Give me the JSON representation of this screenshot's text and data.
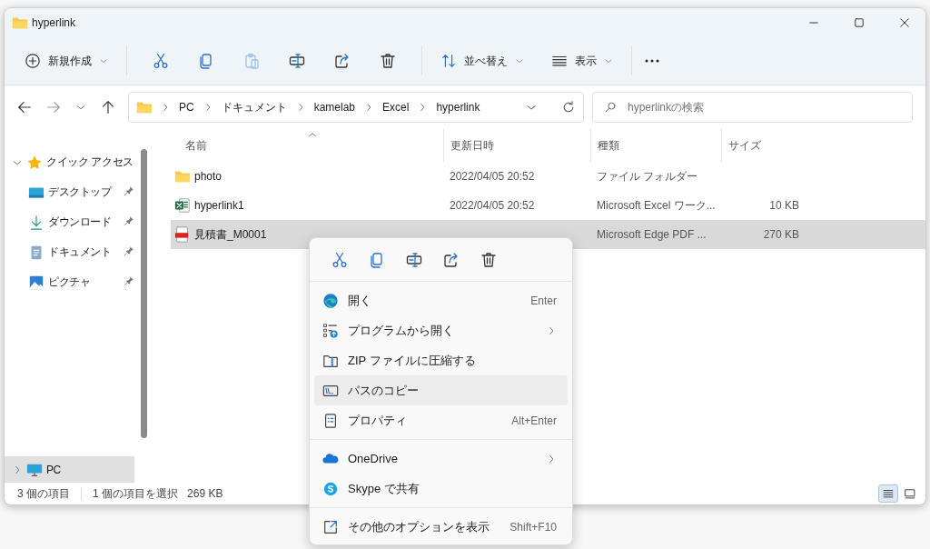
{
  "window": {
    "title": "hyperlink"
  },
  "toolbar": {
    "new_button": "新規作成",
    "actions": [
      {
        "kind": "cut",
        "disabled": false
      },
      {
        "kind": "copy",
        "disabled": false
      },
      {
        "kind": "paste",
        "disabled": true
      },
      {
        "kind": "rename",
        "disabled": false
      },
      {
        "kind": "share",
        "disabled": false
      },
      {
        "kind": "delete",
        "disabled": false
      }
    ],
    "sort_button": "並べ替え",
    "view_button": "表示"
  },
  "address": {
    "segments": [
      "PC",
      "ドキュメント",
      "kamelab",
      "Excel",
      "hyperlink"
    ]
  },
  "search": {
    "placeholder": "hyperlinkの検索"
  },
  "sidebar": {
    "items": [
      {
        "label": "クイック アクセス",
        "kind": "star",
        "expanded": true,
        "selected": false,
        "children": [
          {
            "label": "デスクトップ",
            "kind": "desktop",
            "pinned": true
          },
          {
            "label": "ダウンロード",
            "kind": "download",
            "pinned": true
          },
          {
            "label": "ドキュメント",
            "kind": "document",
            "pinned": true
          },
          {
            "label": "ピクチャ",
            "kind": "pictures",
            "pinned": true
          }
        ]
      },
      {
        "label": "PC",
        "kind": "pc",
        "expanded": false,
        "selected": true
      }
    ]
  },
  "table": {
    "columns": [
      "名前",
      "更新日時",
      "種類",
      "サイズ"
    ],
    "rows": [
      {
        "kind": "folder",
        "name": "photo",
        "modified": "2022/04/05 20:52",
        "type": "ファイル フォルダー",
        "selected": false
      },
      {
        "kind": "excel",
        "name": "hyperlink1",
        "modified": "2022/04/05 20:52",
        "type": "Microsoft Excel ワーク...",
        "size": "10 KB",
        "selected": false
      },
      {
        "kind": "pdf",
        "name": "見積書_M0001",
        "type": "Microsoft Edge PDF ...",
        "size": "270 KB",
        "selected": true
      }
    ]
  },
  "status_bar": {
    "count": "3 個の項目",
    "selection": "1 個の項目を選択",
    "size": "269 KB"
  },
  "view_buttons": [
    {
      "kind": "details",
      "selected": true
    },
    {
      "kind": "tiles",
      "selected": false
    }
  ],
  "context_menu": {
    "actions": [
      {
        "kind": "cut"
      },
      {
        "kind": "copy"
      },
      {
        "kind": "rename"
      },
      {
        "kind": "share"
      },
      {
        "kind": "delete"
      }
    ],
    "sections": [
      {
        "items": [
          {
            "kind": "edge",
            "label": "開く",
            "shortcut": "Enter",
            "submenu": false,
            "highlighted": false
          },
          {
            "kind": "openwith",
            "label": "プログラムから開く",
            "submenu": true,
            "highlighted": false
          },
          {
            "kind": "zip",
            "label": "ZIP ファイルに圧縮する",
            "submenu": false,
            "highlighted": false
          },
          {
            "kind": "copypath",
            "label": "パスのコピー",
            "submenu": false,
            "highlighted": true
          },
          {
            "kind": "properties",
            "label": "プロパティ",
            "shortcut": "Alt+Enter",
            "submenu": false,
            "highlighted": false
          }
        ]
      },
      {
        "items": [
          {
            "kind": "onedrive",
            "label": "OneDrive",
            "submenu": true,
            "highlighted": false
          },
          {
            "kind": "skype",
            "label": "Skype で共有",
            "submenu": false,
            "highlighted": false
          }
        ]
      },
      {
        "items": [
          {
            "kind": "moreoptions",
            "label": "その他のオプションを表示",
            "shortcut": "Shift+F10",
            "submenu": false,
            "highlighted": false
          }
        ]
      }
    ]
  }
}
